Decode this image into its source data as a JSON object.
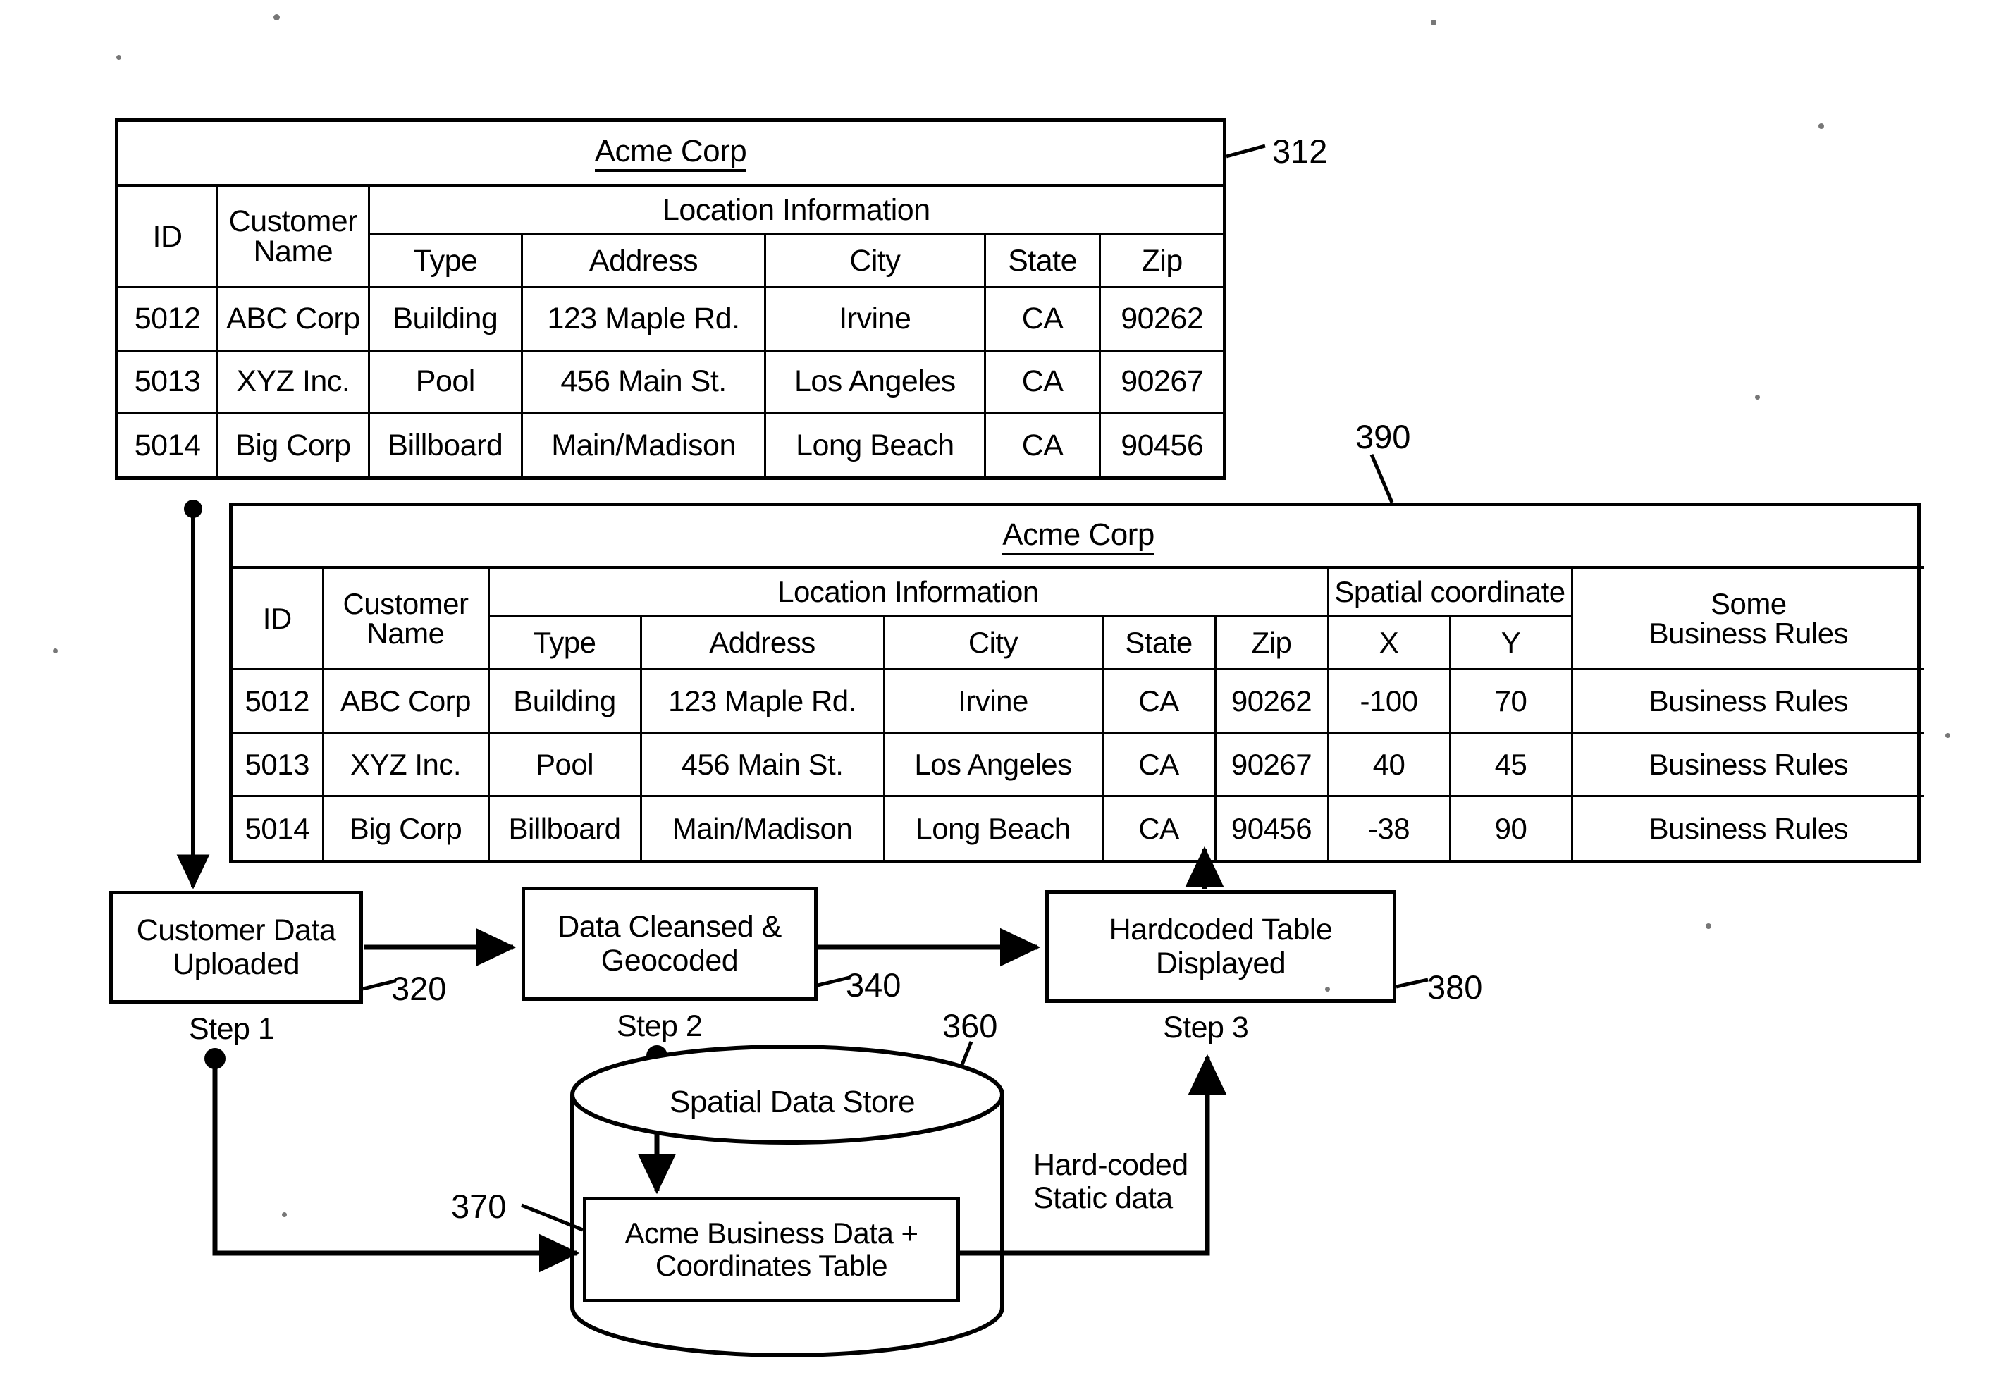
{
  "figure": {
    "title_underline_style": "underlined",
    "ink_color": "#000000",
    "background": "#ffffff"
  },
  "table312": {
    "ref": "312",
    "title": "Acme Corp",
    "headers": {
      "id": "ID",
      "customer_name_line1": "Customer",
      "customer_name_line2": "Name",
      "location_information": "Location Information",
      "type": "Type",
      "address": "Address",
      "city": "City",
      "state": "State",
      "zip": "Zip"
    },
    "rows": [
      {
        "id": "5012",
        "customer_name": "ABC Corp",
        "type": "Building",
        "address": "123 Maple Rd.",
        "city": "Irvine",
        "state": "CA",
        "zip": "90262"
      },
      {
        "id": "5013",
        "customer_name": "XYZ Inc.",
        "type": "Pool",
        "address": "456 Main St.",
        "city": "Los Angeles",
        "state": "CA",
        "zip": "90267"
      },
      {
        "id": "5014",
        "customer_name": "Big Corp",
        "type": "Billboard",
        "address": "Main/Madison",
        "city": "Long Beach",
        "state": "CA",
        "zip": "90456"
      }
    ]
  },
  "table390": {
    "ref": "390",
    "title": "Acme Corp",
    "headers": {
      "id": "ID",
      "customer_name_line1": "Customer",
      "customer_name_line2": "Name",
      "location_information": "Location Information",
      "type": "Type",
      "address": "Address",
      "city": "City",
      "state": "State",
      "zip": "Zip",
      "spatial_coordinate": "Spatial coordinate",
      "x": "X",
      "y": "Y",
      "business_rules_line1": "Some",
      "business_rules_line2": "Business Rules"
    },
    "rows": [
      {
        "id": "5012",
        "customer_name": "ABC Corp",
        "type": "Building",
        "address": "123 Maple Rd.",
        "city": "Irvine",
        "state": "CA",
        "zip": "90262",
        "x": "-100",
        "y": "70",
        "business_rules": "Business Rules"
      },
      {
        "id": "5013",
        "customer_name": "XYZ Inc.",
        "type": "Pool",
        "address": "456 Main St.",
        "city": "Los Angeles",
        "state": "CA",
        "zip": "90267",
        "x": "40",
        "y": "45",
        "business_rules": "Business Rules"
      },
      {
        "id": "5014",
        "customer_name": "Big Corp",
        "type": "Billboard",
        "address": "Main/Madison",
        "city": "Long Beach",
        "state": "CA",
        "zip": "90456",
        "x": "-38",
        "y": "90",
        "business_rules": "Business Rules"
      }
    ]
  },
  "flow": {
    "box320": {
      "ref": "320",
      "line1": "Customer Data",
      "line2": "Uploaded",
      "step": "Step 1"
    },
    "box340": {
      "ref": "340",
      "line1": "Data Cleansed &",
      "line2": "Geocoded",
      "step": "Step 2"
    },
    "box380": {
      "ref": "380",
      "line1": "Hardcoded Table",
      "line2": "Displayed",
      "step": "Step 3"
    },
    "datastore": {
      "ref": "360",
      "label": "Spatial Data Store",
      "inner_ref": "370",
      "inner_line1": "Acme Business Data  +",
      "inner_line2": "Coordinates Table"
    },
    "hardcoded_note_line1": "Hard-coded",
    "hardcoded_note_line2": "Static data"
  }
}
